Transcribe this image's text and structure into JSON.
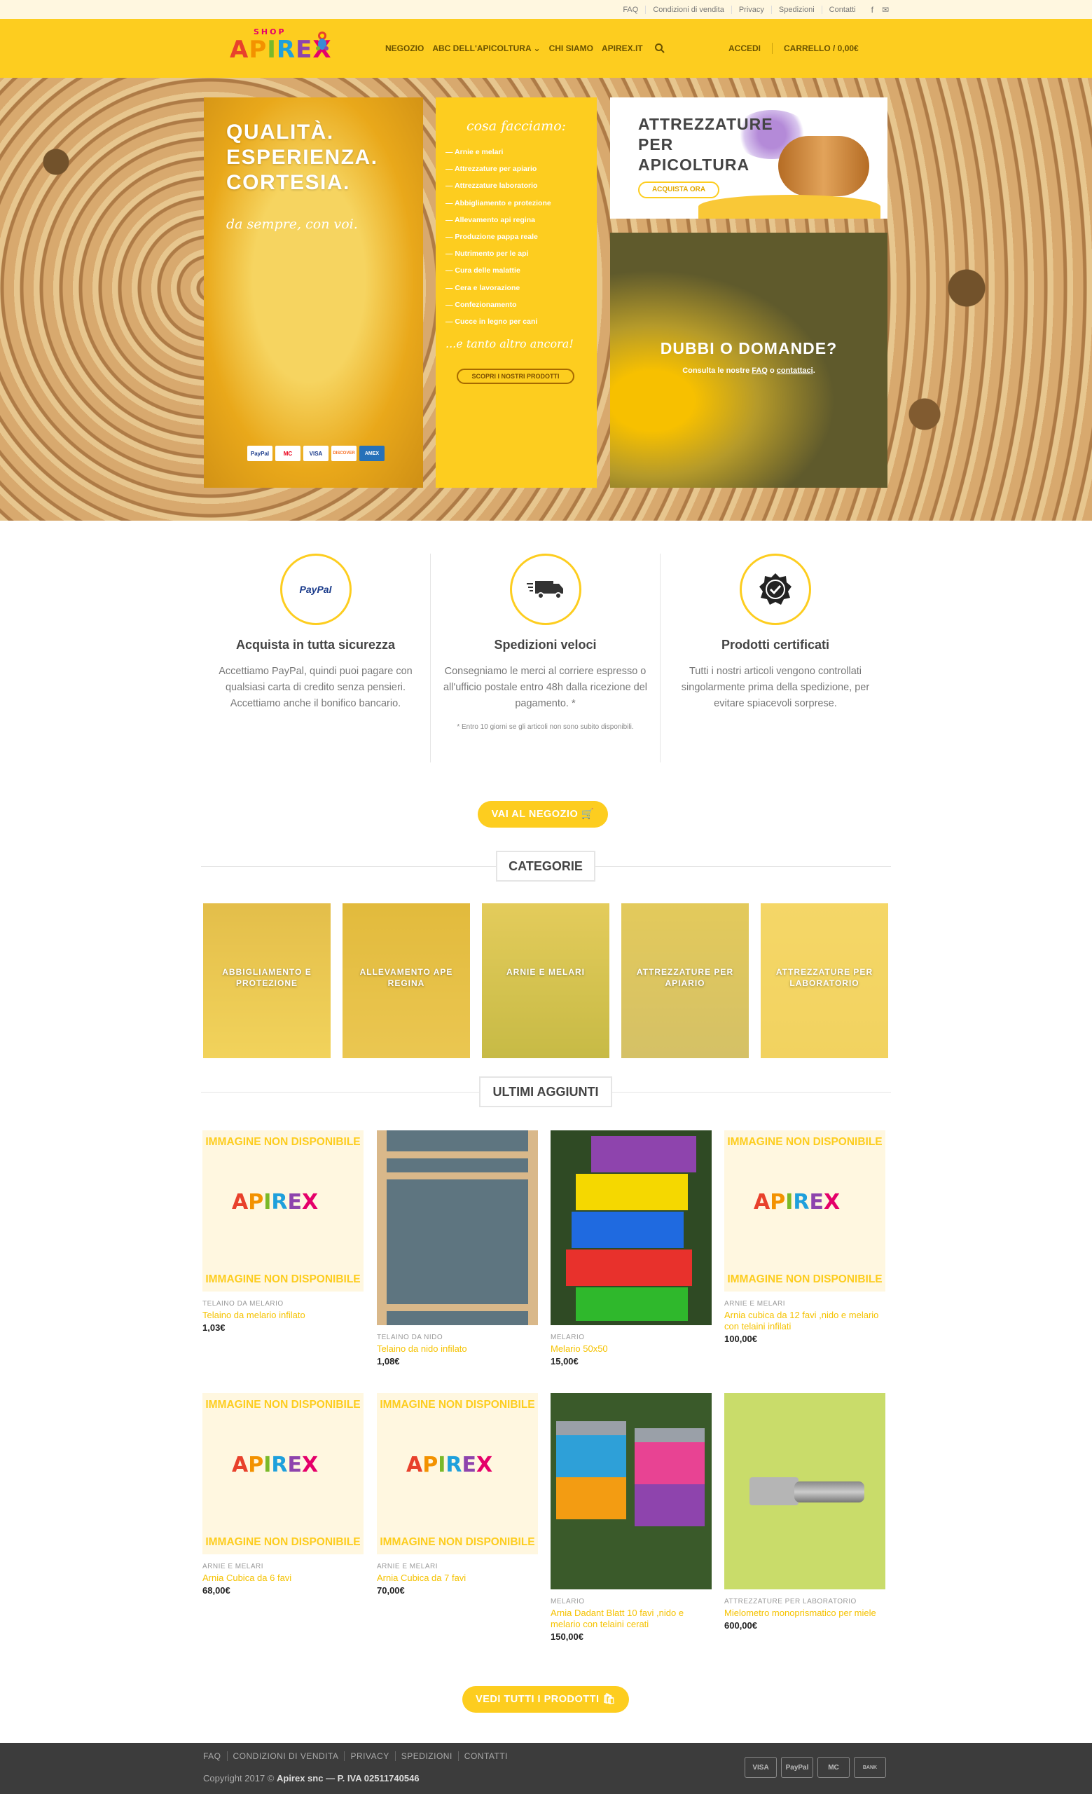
{
  "topbar": {
    "links": [
      "FAQ",
      "Condizioni di vendita",
      "Privacy",
      "Spedizioni",
      "Contatti"
    ]
  },
  "logo": {
    "shop": "SHOP",
    "letters": [
      "A",
      "P",
      "I",
      "R",
      "E",
      "X"
    ]
  },
  "nav": {
    "items": [
      "NEGOZIO",
      "ABC DELL'APICOLTURA",
      "CHI SIAMO",
      "APIREX.IT"
    ],
    "login": "ACCEDI",
    "cart": "CARRELLO / 0,00€"
  },
  "hero": {
    "headline": [
      "QUALITÀ.",
      "ESPERIENZA.",
      "CORTESIA."
    ],
    "tagline": "da sempre, con voi.",
    "payments": [
      "PayPal",
      "MC",
      "VISA",
      "DISCOVER",
      "AMEX"
    ],
    "what_title": "cosa facciamo:",
    "what_items": [
      "— Arnie e melari",
      "— Attrezzature per apiario",
      "— Attrezzature laboratorio",
      "— Abbigliamento e protezione",
      "— Allevamento api regina",
      "— Produzione pappa reale",
      "— Nutrimento per le api",
      "— Cura delle malattie",
      "— Cera e lavorazione",
      "— Confezionamento",
      "— Cucce in legno per cani"
    ],
    "what_more": "...e tanto altro ancora!",
    "what_button": "SCOPRI I NOSTRI PRODOTTI",
    "promo_title": [
      "ATTREZZATURE",
      "PER",
      "APICOLTURA"
    ],
    "promo_button": "ACQUISTA ORA",
    "faq_title": "DUBBI O DOMANDE?",
    "faq_text_pre": "Consulta le nostre ",
    "faq_link": "FAQ",
    "faq_mid": " o ",
    "contact_link": "contattaci",
    "faq_end": "."
  },
  "features": [
    {
      "icon": "paypal-icon",
      "title": "Acquista in tutta sicurezza",
      "desc": "Accettiamo PayPal, quindi puoi pagare con qualsiasi carta di credito senza pensieri. Accettiamo anche il bonifico bancario.",
      "note": ""
    },
    {
      "icon": "truck-icon",
      "title": "Spedizioni veloci",
      "desc": "Consegniamo le merci al corriere espresso o all'ufficio postale entro 48h dalla ricezione del pagamento. *",
      "note": "* Entro 10 giorni se gli articoli non sono subito disponibili."
    },
    {
      "icon": "certified-badge-icon",
      "title": "Prodotti certificati",
      "desc": "Tutti i nostri articoli vengono controllati singolarmente prima della spedizione, per evitare spiacevoli sorprese.",
      "note": ""
    }
  ],
  "paypal_label": "PayPal",
  "shop_button": "VAI AL NEGOZIO",
  "categories_title": "CATEGORIE",
  "categories": [
    "ABBIGLIAMENTO E PROTEZIONE",
    "ALLEVAMENTO APE REGINA",
    "ARNIE E MELARI",
    "ATTREZZATURE PER APIARIO",
    "ATTREZZATURE PER LABORATORIO"
  ],
  "latest_title": "ULTIMI AGGIUNTI",
  "no_image": "IMMAGINE NON DISPONIBILE",
  "products": [
    {
      "cat": "TELAINO DA MELARIO",
      "name": "Telaino da melario infilato",
      "price": "1,03€"
    },
    {
      "cat": "TELAINO DA NIDO",
      "name": "Telaino da nido infilato",
      "price": "1,08€"
    },
    {
      "cat": "MELARIO",
      "name": "Melario 50x50",
      "price": "15,00€"
    },
    {
      "cat": "ARNIE E MELARI",
      "name": "Arnia cubica da 12 favi ,nido e melario con telaini infilati",
      "price": "100,00€"
    },
    {
      "cat": "ARNIE E MELARI",
      "name": "Arnia Cubica da 6 favi",
      "price": "68,00€"
    },
    {
      "cat": "ARNIE E MELARI",
      "name": "Arnia Cubica da 7 favi",
      "price": "70,00€"
    },
    {
      "cat": "MELARIO",
      "name": "Arnia Dadant Blatt 10 favi ,nido e melario con telaini cerati",
      "price": "150,00€"
    },
    {
      "cat": "ATTREZZATURE PER LABORATORIO",
      "name": "Mielometro monoprismatico per miele",
      "price": "600,00€"
    }
  ],
  "all_button": "VEDI TUTTI I PRODOTTI",
  "footer": {
    "links": [
      "FAQ",
      "CONDIZIONI DI VENDITA",
      "PRIVACY",
      "SPEDIZIONI",
      "CONTATTI"
    ],
    "copy_pre": "Copyright 2017 © ",
    "copy_bold": "Apirex snc — P. IVA 02511740546",
    "cards": [
      "VISA",
      "PayPal",
      "MC",
      "BANK"
    ]
  },
  "colors": {
    "brand_yellow": "#fdcd1f",
    "footer": "#3c3c3c",
    "topbar": "#fff7e0"
  }
}
